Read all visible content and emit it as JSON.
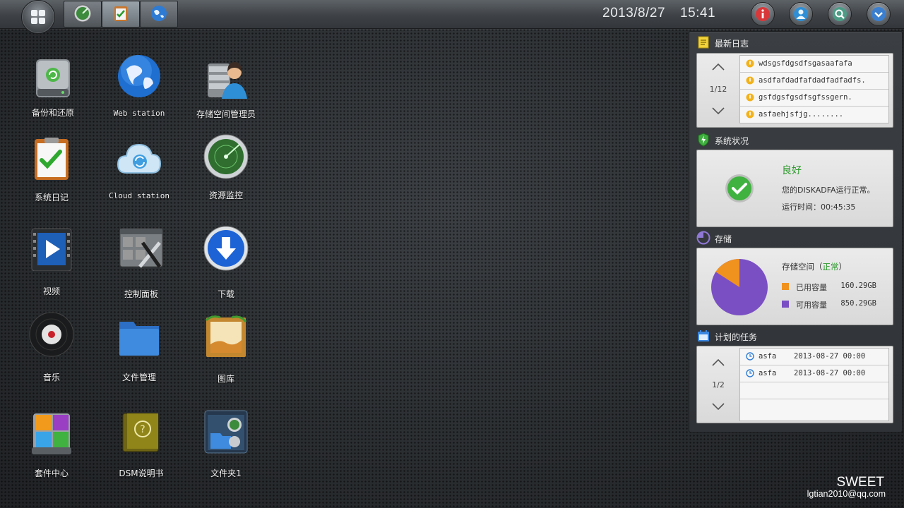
{
  "topbar": {
    "date": "2013/8/27",
    "time": "15:41",
    "start_icon": "grid-icon",
    "tasks": [
      {
        "icon": "gauge-icon"
      },
      {
        "icon": "clipboard-icon"
      },
      {
        "icon": "globe-icon"
      }
    ],
    "buttons": [
      "info-icon",
      "user-icon",
      "search-icon",
      "chevron-down-icon"
    ]
  },
  "desktop": {
    "icons": [
      {
        "label": "备份和还原",
        "icon": "backup-drive-icon"
      },
      {
        "label": "Web station",
        "icon": "globe-icon"
      },
      {
        "label": "存储空间管理员",
        "icon": "storage-admin-icon"
      },
      {
        "label": "系统日记",
        "icon": "clipboard-check-icon"
      },
      {
        "label": "Cloud station",
        "icon": "cloud-sync-icon"
      },
      {
        "label": "资源监控",
        "icon": "radar-gauge-icon"
      },
      {
        "label": "视频",
        "icon": "video-player-icon"
      },
      {
        "label": "控制面板",
        "icon": "control-panel-tools-icon"
      },
      {
        "label": "下载",
        "icon": "download-arrow-icon"
      },
      {
        "label": "音乐",
        "icon": "vinyl-record-icon"
      },
      {
        "label": "文件管理",
        "icon": "folder-icon"
      },
      {
        "label": "图库",
        "icon": "picture-frame-icon"
      },
      {
        "label": "套件中心",
        "icon": "package-center-icon"
      },
      {
        "label": "DSM说明书",
        "icon": "help-book-icon"
      },
      {
        "label": "文件夹1",
        "icon": "folder-window-icon"
      }
    ]
  },
  "panel": {
    "log": {
      "title": "最新日志",
      "page": "1/12",
      "entries": [
        "wdsgsfdgsdfsgasaafafa",
        "asdfafdadfafdadfadfadfs.",
        "gsfdgsfgsdfsgfssgern.",
        "asfaehjsfjg........"
      ]
    },
    "status": {
      "title": "系统状况",
      "state": "良好",
      "message": "您的DISKADFA运行正常。",
      "uptime": "运行时间：00:45:35"
    },
    "storage": {
      "title": "存储",
      "space_label": "存储空间（",
      "space_status": "正常",
      "space_suffix": "）",
      "used_label": "已用容量",
      "used_value": "160.29GB",
      "free_label": "可用容量",
      "free_value": "850.29GB",
      "used_gb": 160.29,
      "free_gb": 850.29,
      "used_color": "#f0921e",
      "free_color": "#7a4fc4"
    },
    "tasks": {
      "title": "计划的任务",
      "page": "1/2",
      "items": [
        {
          "name": "asfa",
          "time": "2013-08-27   00:00"
        },
        {
          "name": "asfa",
          "time": "2013-08-27   00:00"
        }
      ]
    }
  },
  "footer": {
    "brand": "SWEET",
    "email": "lgtian2010@qq.com"
  }
}
